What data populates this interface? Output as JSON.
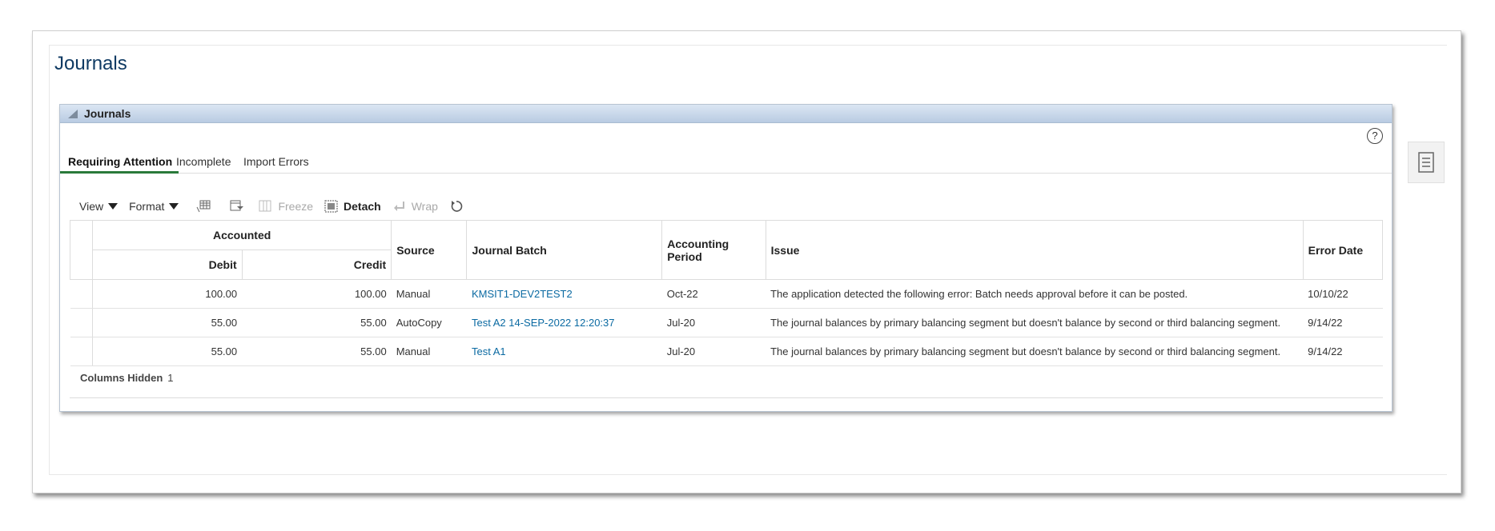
{
  "page": {
    "title": "Journals"
  },
  "panel": {
    "header": "Journals",
    "help": "?"
  },
  "tabs": [
    {
      "label": "Requiring Attention",
      "active": true
    },
    {
      "label": "Incomplete",
      "active": false
    },
    {
      "label": "Import Errors",
      "active": false
    }
  ],
  "toolbar": {
    "view": "View",
    "format": "Format",
    "freeze": "Freeze",
    "detach": "Detach",
    "wrap": "Wrap"
  },
  "table": {
    "headers": {
      "accounted": "Accounted",
      "debit": "Debit",
      "credit": "Credit",
      "source": "Source",
      "journal_batch": "Journal Batch",
      "accounting_period": "Accounting Period",
      "issue": "Issue",
      "error_date": "Error Date"
    },
    "rows": [
      {
        "debit": "100.00",
        "credit": "100.00",
        "source": "Manual",
        "journal_batch": "KMSIT1-DEV2TEST2",
        "period": "Oct-22",
        "issue": "The application detected the following error: Batch needs approval before it can be posted.",
        "error_date": "10/10/22"
      },
      {
        "debit": "55.00",
        "credit": "55.00",
        "source": "AutoCopy",
        "journal_batch": "Test A2 14-SEP-2022 12:20:37",
        "period": "Jul-20",
        "issue": "The journal balances by primary balancing segment but doesn't balance by second or third balancing segment.",
        "error_date": "9/14/22"
      },
      {
        "debit": "55.00",
        "credit": "55.00",
        "source": "Manual",
        "journal_batch": "Test A1",
        "period": "Jul-20",
        "issue": "The journal balances by primary balancing segment but doesn't balance by second or third balancing segment.",
        "error_date": "9/14/22"
      }
    ]
  },
  "footer": {
    "columns_hidden_label": "Columns Hidden",
    "columns_hidden_count": "1"
  },
  "colors": {
    "title": "#0f3a63",
    "link": "#0b6aa2",
    "tab_active": "#2a7a3a"
  },
  "icons": [
    "collapse-triangle-icon",
    "help-icon",
    "query-by-example-icon",
    "filter-icon",
    "freeze-icon",
    "detach-icon",
    "wrap-icon",
    "refresh-icon",
    "side-panel-icon"
  ]
}
